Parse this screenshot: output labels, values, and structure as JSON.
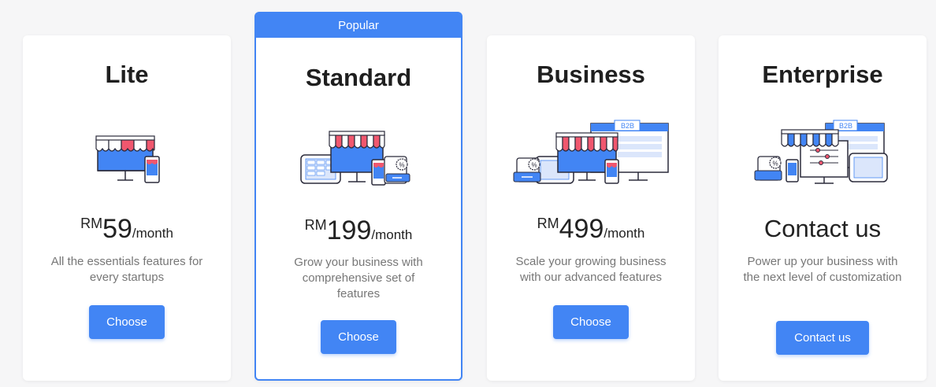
{
  "plans": [
    {
      "name": "Lite",
      "currency": "RM",
      "amount": "59",
      "period": "/month",
      "description": "All the essentials features for every startups",
      "button_label": "Choose"
    },
    {
      "badge": "Popular",
      "name": "Standard",
      "currency": "RM",
      "amount": "199",
      "period": "/month",
      "description": "Grow your business with comprehensive set of features",
      "button_label": "Choose"
    },
    {
      "name": "Business",
      "currency": "RM",
      "amount": "499",
      "period": "/month",
      "description": "Scale your growing business with our advanced features",
      "button_label": "Choose",
      "illustration_tag": "B2B"
    },
    {
      "name": "Enterprise",
      "price_text": "Contact us",
      "description": "Power up your business with the next level of customization",
      "button_label": "Contact us",
      "illustration_tag": "B2B"
    }
  ],
  "colors": {
    "accent": "#4285f4",
    "awning_red": "#f0576e",
    "outline": "#2b2b3b",
    "background": "#f6f6f7"
  },
  "icons": [
    "storefront-icon",
    "storefront-pos-icon",
    "b2b-store-icon",
    "enterprise-store-icon"
  ]
}
